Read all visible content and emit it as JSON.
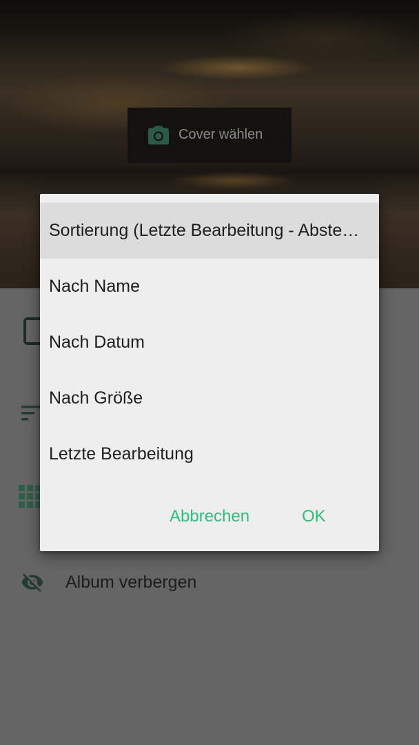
{
  "header": {
    "cover_button_label": "Cover wählen",
    "cover_icon": "camera-icon"
  },
  "list": {
    "items": [
      {
        "icon": "tablet-icon",
        "label": ""
      },
      {
        "icon": "sort-icon",
        "label": ""
      },
      {
        "icon": "grid-icon",
        "label": ""
      },
      {
        "icon": "visibility-off-icon",
        "label": "Album verbergen"
      }
    ]
  },
  "dialog": {
    "options": [
      {
        "label": "Sortierung (Letzte Bearbeitung - Absteigend)",
        "selected": true
      },
      {
        "label": "Nach Name",
        "selected": false
      },
      {
        "label": "Nach Datum",
        "selected": false
      },
      {
        "label": "Nach Größe",
        "selected": false
      },
      {
        "label": "Letzte Bearbeitung",
        "selected": false
      }
    ],
    "cancel_label": "Abbrechen",
    "ok_label": "OK"
  },
  "colors": {
    "accent": "#2dbd7c",
    "dialog_background": "#eeeeee",
    "scrim": "#656565",
    "icon_tint": "#2f5f4b"
  }
}
